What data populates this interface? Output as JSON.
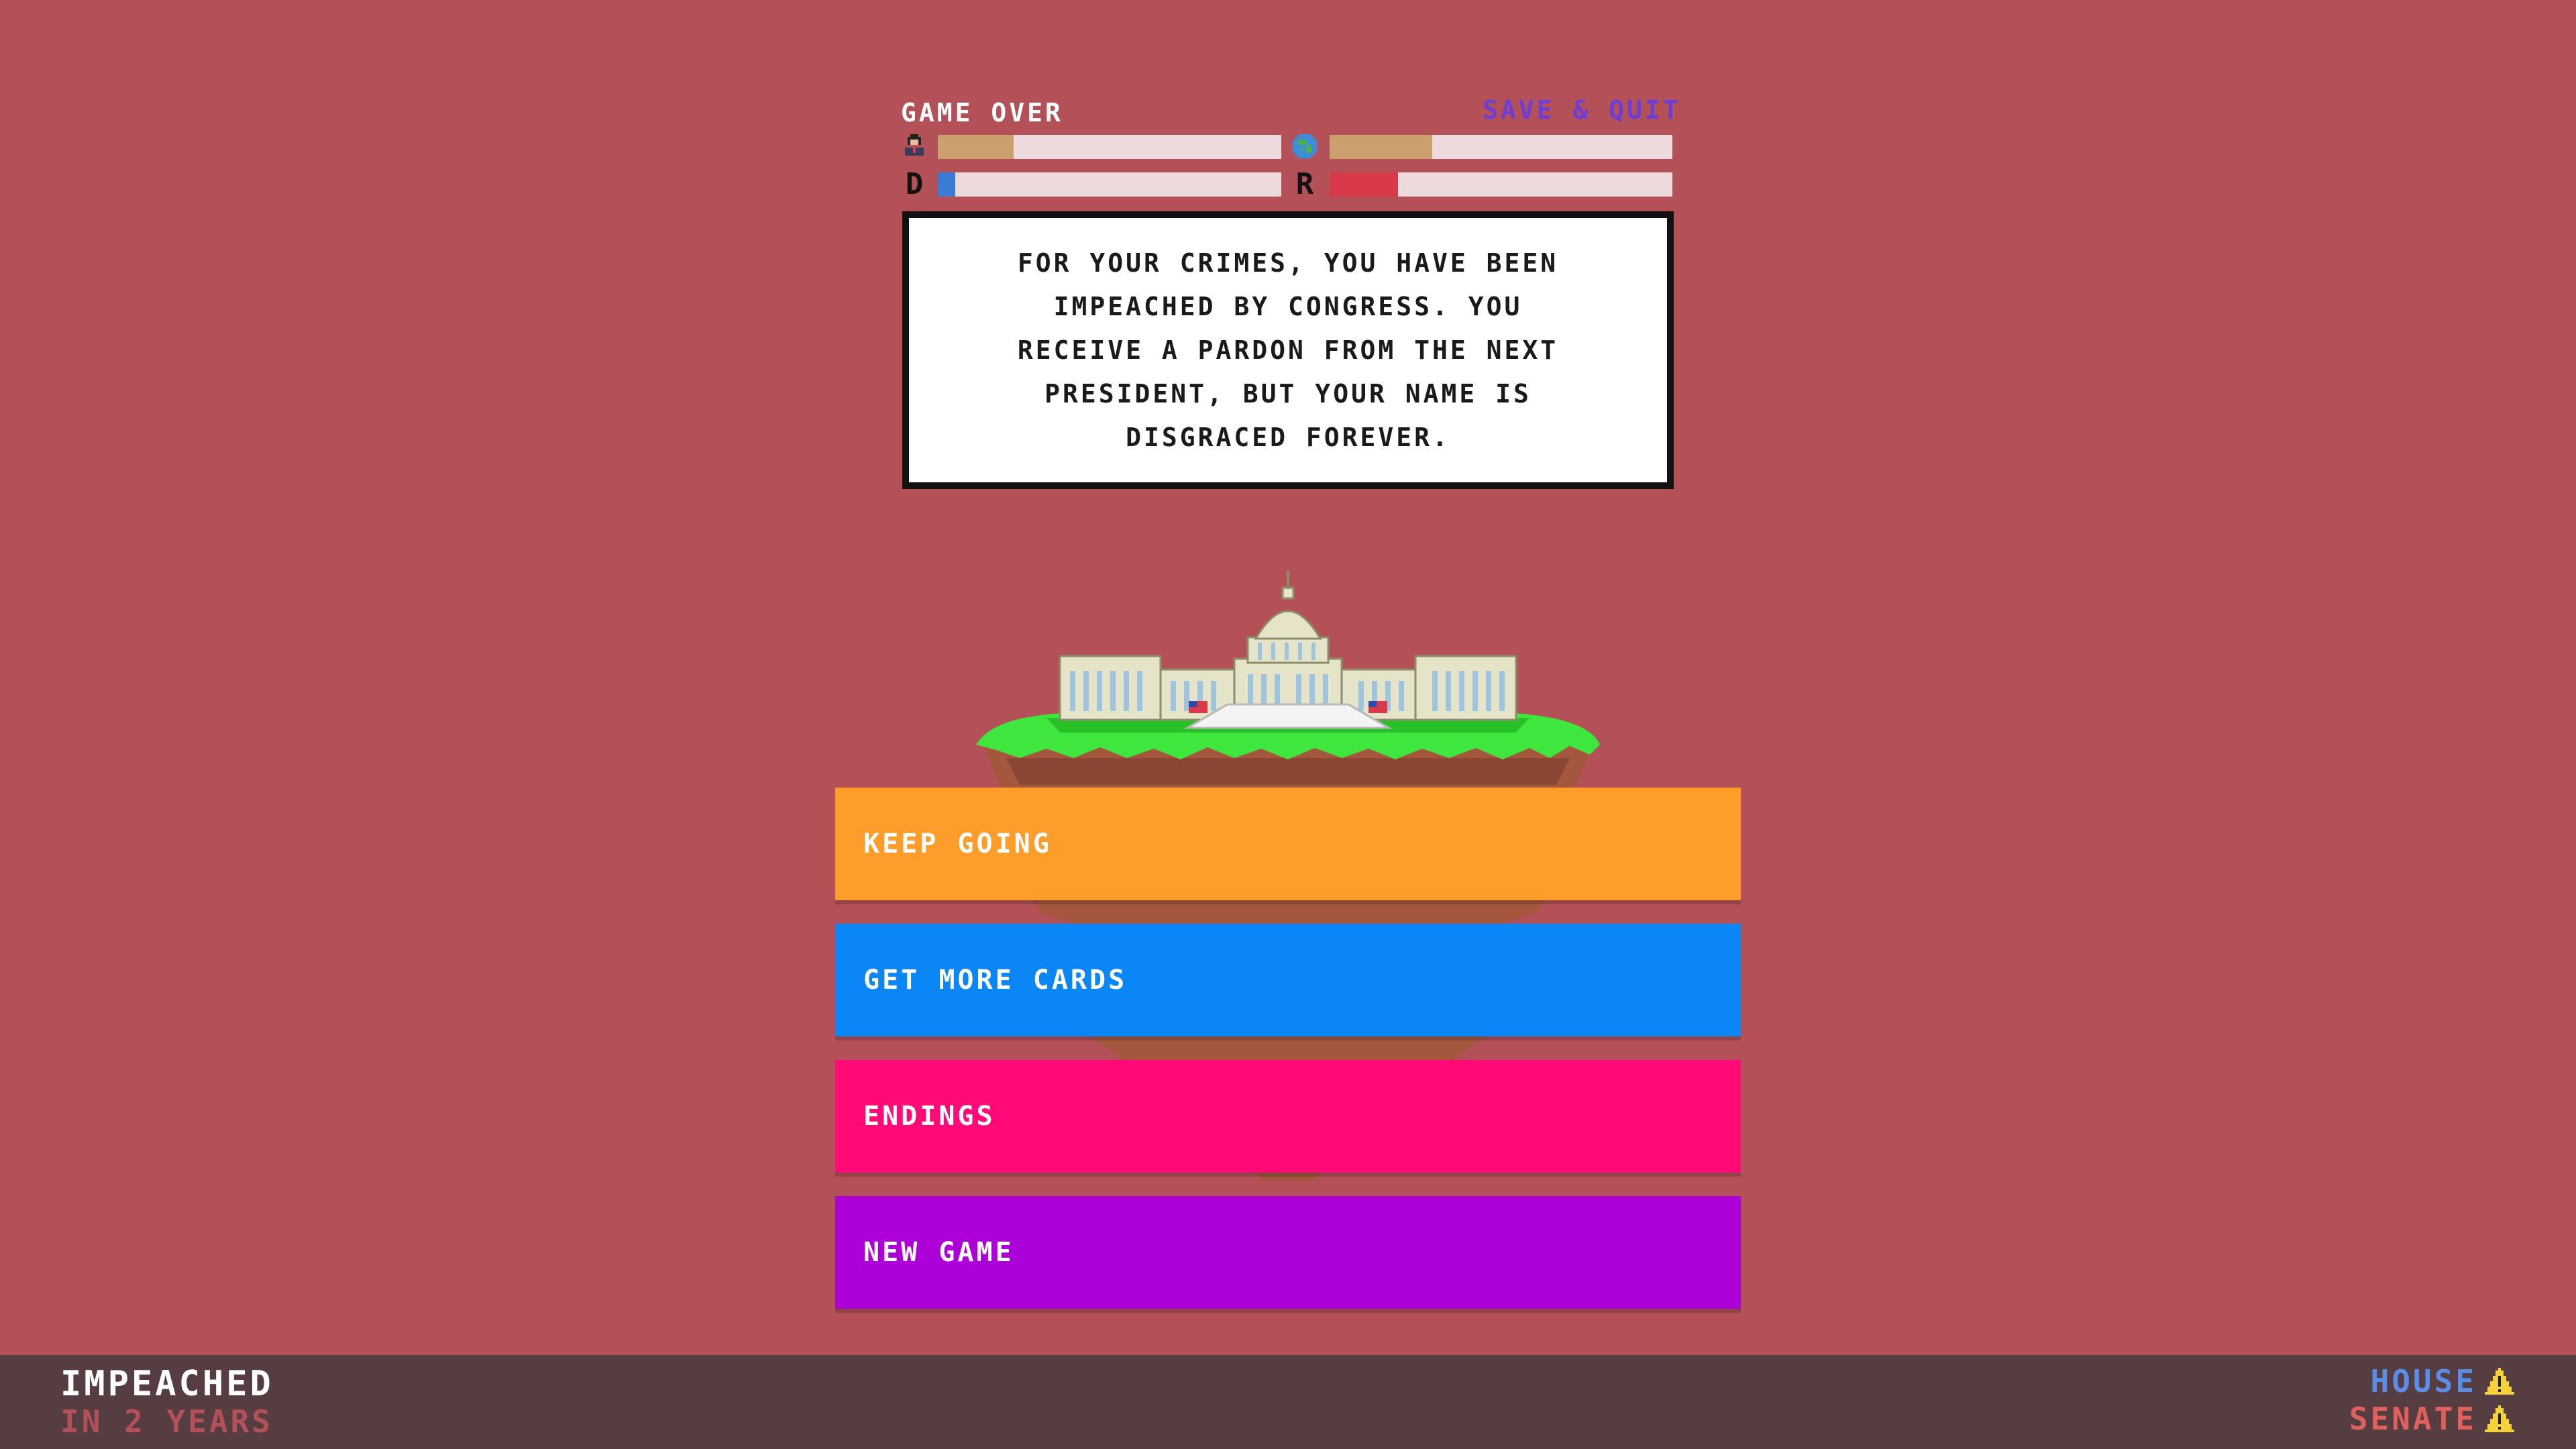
{
  "hud": {
    "status_label": "GAME OVER",
    "save_quit_label": "SAVE & QUIT",
    "meters": {
      "people": 0.22,
      "world": 0.3,
      "democrats": 0.05,
      "republicans": 0.2
    },
    "party_labels": {
      "democrats": "D",
      "republicans": "R"
    },
    "colors": {
      "people_fill": "#c9a06e",
      "world_fill": "#c9a06e",
      "democrats_fill": "#3a7bd5",
      "republicans_fill": "#d83a4a"
    }
  },
  "message": "FOR YOUR CRIMES, YOU HAVE BEEN IMPEACHED BY CONGRESS. YOU RECEIVE A PARDON FROM THE NEXT PRESIDENT, BUT YOUR NAME IS DISGRACED FOREVER.",
  "menu": [
    {
      "label": "KEEP GOING",
      "color": "#ff9d2a"
    },
    {
      "label": "GET MORE CARDS",
      "color": "#0a86f7"
    },
    {
      "label": "ENDINGS",
      "color": "#ff0a76"
    },
    {
      "label": "NEW GAME",
      "color": "#ad00d8"
    }
  ],
  "status": {
    "title": "IMPEACHED",
    "subtitle": "IN 2 YEARS",
    "house_label": "HOUSE",
    "senate_label": "SENATE",
    "house_color": "#5a8ee6",
    "senate_color": "#e0605e",
    "warning_icon": "warning-icon"
  }
}
